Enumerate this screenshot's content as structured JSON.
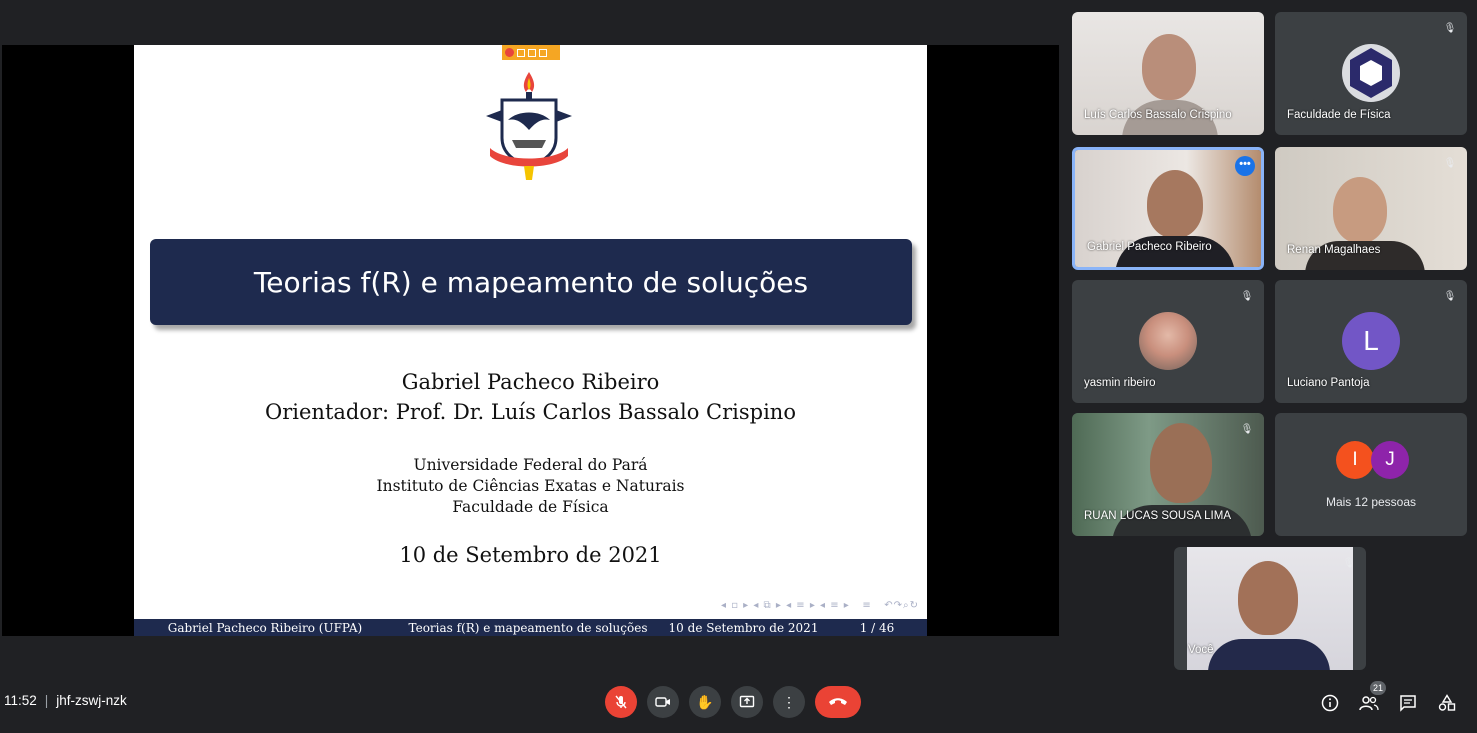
{
  "slide": {
    "title": "Teorias f(R) e mapeamento de soluções",
    "author": "Gabriel Pacheco Ribeiro",
    "advisor": "Orientador: Prof. Dr. Luís Carlos Bassalo Crispino",
    "institution_lines": [
      "Universidade Federal do Pará",
      "Instituto de Ciências Exatas e Naturais",
      "Faculdade de Física"
    ],
    "date": "10 de Setembro de 2021",
    "footer": {
      "author": "Gabriel Pacheco Ribeiro (UFPA)",
      "title": "Teorias f(R) e mapeamento de soluções",
      "date": "10 de Setembro de 2021",
      "page": "1 / 46"
    }
  },
  "participants": [
    {
      "name": "Luís Carlos Bassalo Crispino"
    },
    {
      "name": "Faculdade de Física"
    },
    {
      "name": "Gabriel Pacheco Ribeiro"
    },
    {
      "name": "Renan Magalhaes"
    },
    {
      "name": "yasmin ribeiro"
    },
    {
      "name": "Luciano Pantoja",
      "initial": "L"
    },
    {
      "name": "RUAN LUCAS SOUSA LIMA"
    },
    {
      "name": "Mais 12 pessoas",
      "initials": [
        "I",
        "J"
      ]
    },
    {
      "name": "Você"
    }
  ],
  "meeting": {
    "time": "11:52",
    "separator": "|",
    "code": "jhf-zswj-nzk"
  },
  "participant_count": "21",
  "colors": {
    "background": "#202124",
    "tile": "#3c4043",
    "danger": "#ea4335",
    "active_border": "#8ab4f8",
    "slide_blue": "#1e2a4e"
  }
}
